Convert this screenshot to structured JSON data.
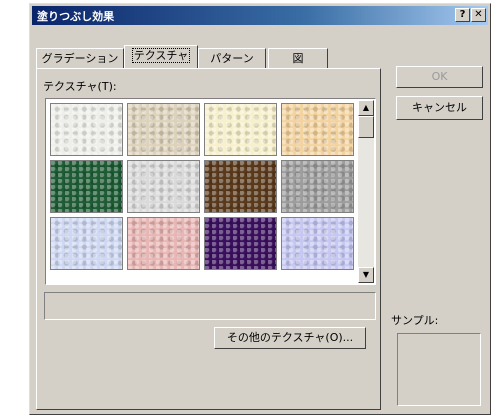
{
  "window": {
    "title": "塗りつぶし効果",
    "help_label": "?",
    "close_label": "✕"
  },
  "tabs": [
    {
      "label": "グラデーション"
    },
    {
      "label": "テクスチャ"
    },
    {
      "label": "パターン"
    },
    {
      "label": "図"
    }
  ],
  "texture_label": "テクスチャ(T):",
  "textures": [
    {
      "name": "newsprint",
      "color": "#eeeeea"
    },
    {
      "name": "canvas",
      "color": "#ddd2bb"
    },
    {
      "name": "parchment",
      "color": "#f7f0cc"
    },
    {
      "name": "stationery",
      "color": "#f3d3a0"
    },
    {
      "name": "green-marble",
      "color": "#1d5c34"
    },
    {
      "name": "white-marble",
      "color": "#dadada"
    },
    {
      "name": "brown-marble",
      "color": "#5b3a1c"
    },
    {
      "name": "granite",
      "color": "#9d9d9d"
    },
    {
      "name": "blue-tissue-paper",
      "color": "#cfd8f2"
    },
    {
      "name": "pink-tissue-paper",
      "color": "#e8b6b4"
    },
    {
      "name": "purple-mesh",
      "color": "#3a0f5e"
    },
    {
      "name": "bouquet",
      "color": "#c6c8f2"
    }
  ],
  "scroll": {
    "up": "▲",
    "down": "▼"
  },
  "other_texture_button": "その他のテクスチャ(O)...",
  "ok_button": "OK",
  "cancel_button": "キャンセル",
  "sample_label": "サンプル:"
}
